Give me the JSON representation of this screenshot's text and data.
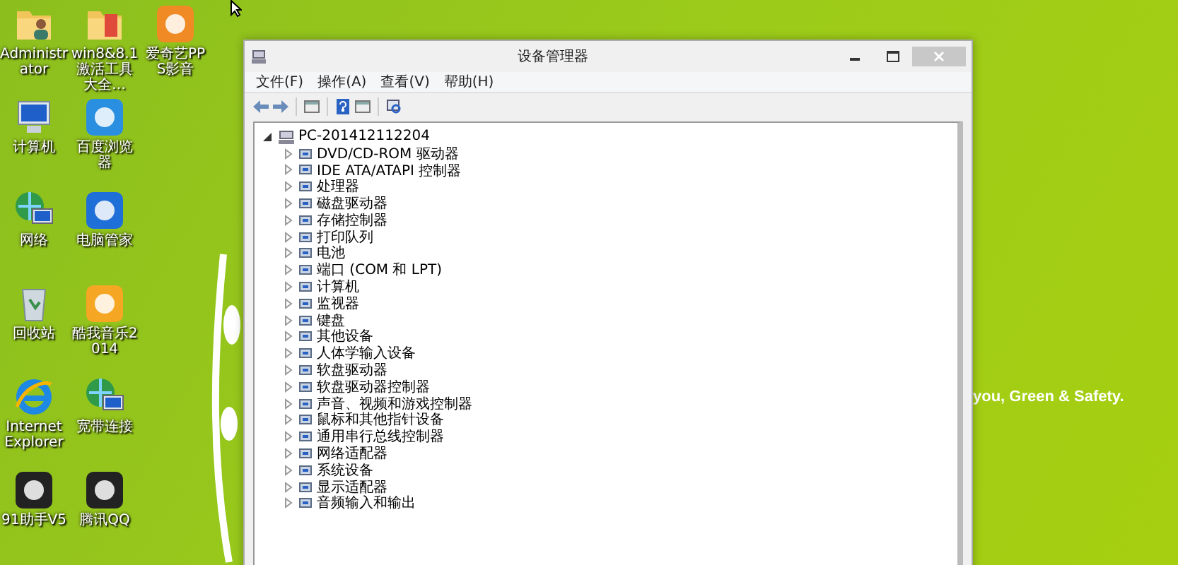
{
  "desktop": {
    "icons": [
      {
        "label": "Administrator",
        "kind": "user-folder"
      },
      {
        "label": "计算机",
        "kind": "computer"
      },
      {
        "label": "网络",
        "kind": "network"
      },
      {
        "label": "回收站",
        "kind": "trash"
      },
      {
        "label": "Internet Explorer",
        "kind": "browser"
      },
      {
        "label": "91助手V5",
        "kind": "app"
      },
      {
        "label": "win8&8.1激活工具大全…",
        "kind": "folder"
      },
      {
        "label": "百度浏览器",
        "kind": "app"
      },
      {
        "label": "电脑管家",
        "kind": "app"
      },
      {
        "label": "酷我音乐2014",
        "kind": "app"
      },
      {
        "label": "宽带连接",
        "kind": "network"
      },
      {
        "label": "腾讯QQ",
        "kind": "app"
      },
      {
        "label": "爱奇艺PPS影音",
        "kind": "app"
      }
    ],
    "wallpaper_text": "you, Green & Safety."
  },
  "window": {
    "title": "设备管理器",
    "menu": [
      "文件(F)",
      "操作(A)",
      "查看(V)",
      "帮助(H)"
    ],
    "tree": [
      {
        "label": "PC-201412112204",
        "expanded": true,
        "children": [
          {
            "label": "DVD/CD-ROM 驱动器",
            "expanded": false
          },
          {
            "label": "IDE ATA/ATAPI 控制器",
            "expanded": false
          },
          {
            "label": "处理器",
            "expanded": false
          },
          {
            "label": "磁盘驱动器",
            "expanded": false
          },
          {
            "label": "存储控制器",
            "expanded": false
          },
          {
            "label": "打印队列",
            "expanded": false
          },
          {
            "label": "电池",
            "expanded": false
          },
          {
            "label": "端口 (COM 和 LPT)",
            "expanded": false
          },
          {
            "label": "计算机",
            "expanded": false
          },
          {
            "label": "监视器",
            "expanded": false
          },
          {
            "label": "键盘",
            "expanded": false
          },
          {
            "label": "其他设备",
            "expanded": false
          },
          {
            "label": "人体学输入设备",
            "expanded": false
          },
          {
            "label": "软盘驱动器",
            "expanded": false
          },
          {
            "label": "软盘驱动器控制器",
            "expanded": false
          },
          {
            "label": "声音、视频和游戏控制器",
            "expanded": false
          },
          {
            "label": "鼠标和其他指针设备",
            "expanded": false
          },
          {
            "label": "通用串行总线控制器",
            "expanded": false
          },
          {
            "label": "网络适配器",
            "expanded": false
          },
          {
            "label": "系统设备",
            "expanded": false
          },
          {
            "label": "显示适配器",
            "expanded": false
          },
          {
            "label": "音频输入和输出",
            "expanded": false
          }
        ]
      }
    ]
  }
}
